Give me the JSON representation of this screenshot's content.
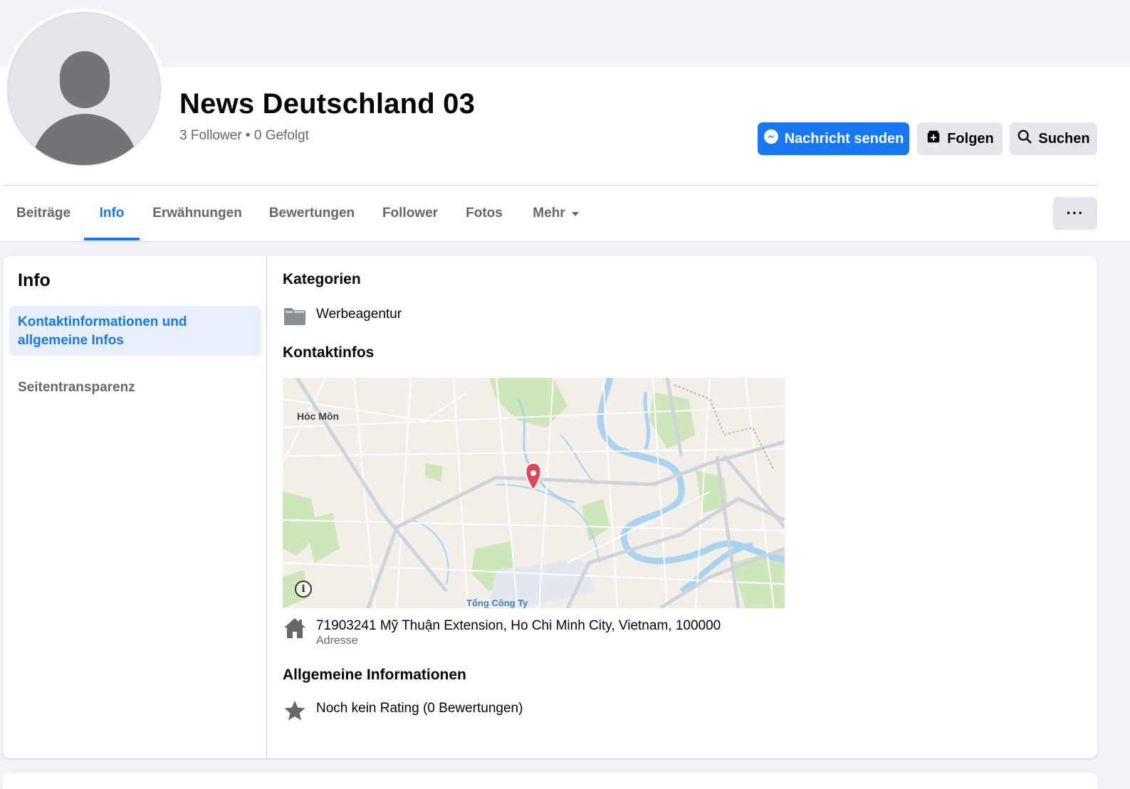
{
  "page": {
    "title": "News Deutschland 03",
    "stats": "3 Follower • 0 Gefolgt"
  },
  "actions": {
    "message_label": "Nachricht senden",
    "follow_label": "Folgen",
    "search_label": "Suchen",
    "more_label": "···"
  },
  "tabs": [
    {
      "label": "Beiträge"
    },
    {
      "label": "Info"
    },
    {
      "label": "Erwähnungen"
    },
    {
      "label": "Bewertungen"
    },
    {
      "label": "Follower"
    },
    {
      "label": "Fotos"
    },
    {
      "label": "Mehr"
    }
  ],
  "active_tab": "Info",
  "sidebar": {
    "title": "Info",
    "items": [
      {
        "label": "Kontaktinformationen und allgemeine Infos"
      },
      {
        "label": "Seitentransparenz"
      }
    ]
  },
  "about": {
    "categories_title": "Kategorien",
    "category": "Werbeagentur",
    "contact_title": "Kontaktinfos",
    "map": {
      "label_hocmon": "Hóc Môn",
      "label_tongcongty": "Tổng Công Ty",
      "info_glyph": "i"
    },
    "address": "71903241 Mỹ Thuận Extension, Ho Chi Minh City, Vietnam, 100000",
    "address_label": "Adresse",
    "general_title": "Allgemeine Informationen",
    "rating": "Noch kein Rating (0 Bewertungen)"
  },
  "colors": {
    "accent": "#1877f2",
    "secondary_text": "#65676b",
    "button_grey": "#e4e6eb",
    "map_pin": "#e0485a"
  },
  "icons": {
    "message": "messenger-icon",
    "follow": "follow-icon",
    "search": "search-icon",
    "dropdown": "caret-down-icon",
    "category": "folder-icon",
    "address": "home-icon",
    "rating": "star-icon",
    "map_pin": "map-pin-icon"
  }
}
